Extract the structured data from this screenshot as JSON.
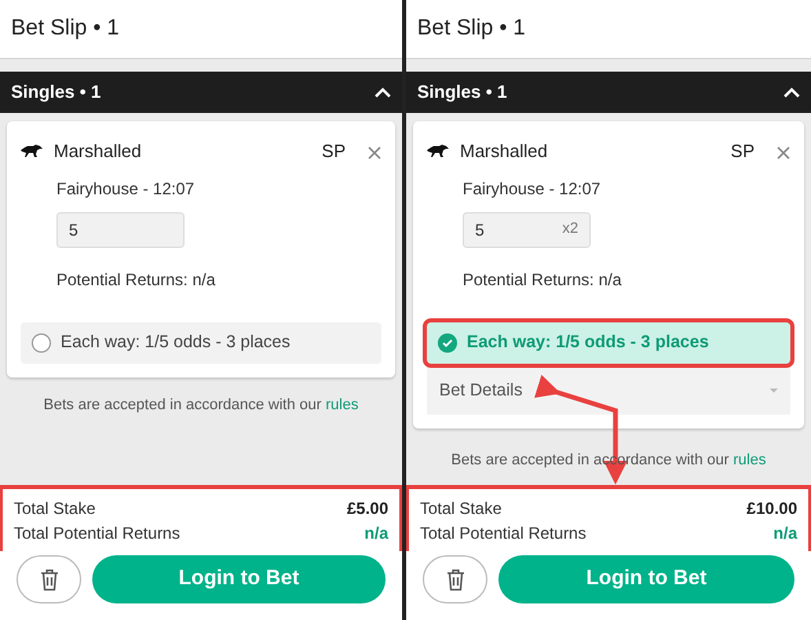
{
  "panels": [
    {
      "title": "Bet Slip • 1",
      "section": {
        "label": "Singles • 1",
        "expanded": true
      },
      "bet": {
        "selection": "Marshalled",
        "price": "SP",
        "event": "Fairyhouse - 12:07",
        "stake": "5",
        "potential_returns": "Potential Returns: n/a",
        "each_way": {
          "label": "Each way: 1/5 odds - 3 places",
          "checked": false,
          "highlighted": false
        }
      },
      "rules_text": "Bets are accepted in accordance with our",
      "rules_link": "rules",
      "totals": {
        "highlighted": true,
        "stake_label": "Total Stake",
        "stake": "£5.00",
        "returns_label": "Total Potential Returns",
        "returns": "n/a"
      },
      "login_button": "Login to Bet"
    },
    {
      "title": "Bet Slip • 1",
      "section": {
        "label": "Singles • 1",
        "expanded": true
      },
      "bet": {
        "selection": "Marshalled",
        "price": "SP",
        "event": "Fairyhouse - 12:07",
        "stake": "5",
        "multiplier": "x2",
        "potential_returns": "Potential Returns: n/a",
        "each_way": {
          "label": "Each way: 1/5 odds - 3 places",
          "checked": true,
          "highlighted": true
        },
        "bet_details": "Bet Details"
      },
      "rules_text": "Bets are accepted in accordance with our",
      "rules_link": "rules",
      "totals": {
        "highlighted": true,
        "stake_label": "Total Stake",
        "stake": "£10.00",
        "returns_label": "Total Potential Returns",
        "returns": "n/a"
      },
      "login_button": "Login to Bet",
      "arrow": true
    }
  ]
}
